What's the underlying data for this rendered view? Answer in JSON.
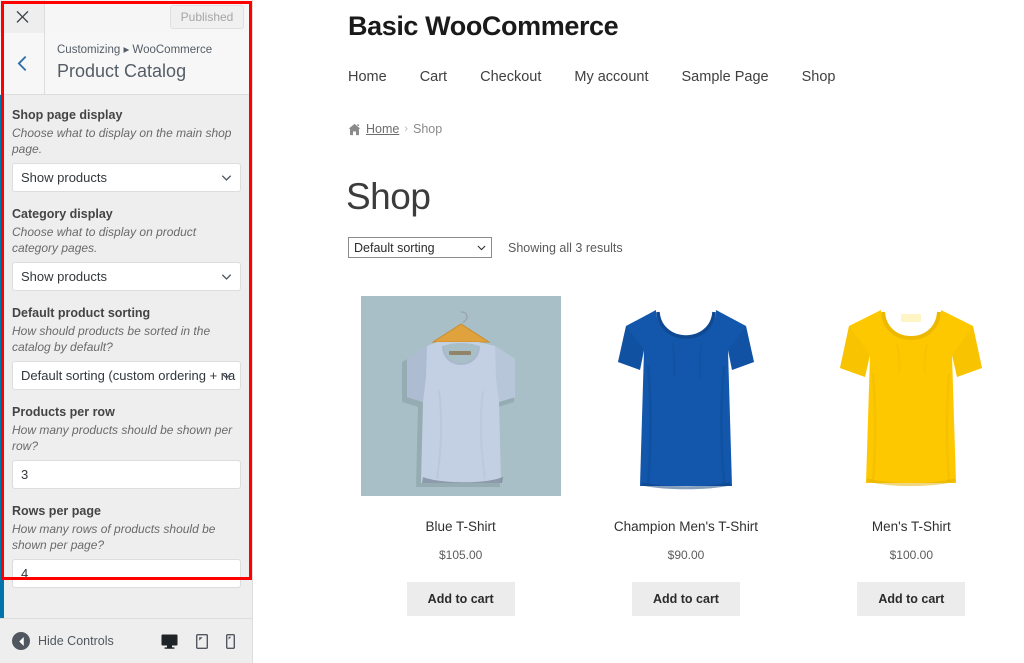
{
  "customizer": {
    "close_icon": "close-icon",
    "published_label": "Published",
    "back_icon": "chevron-left-icon",
    "breadcrumb": "Customizing ▸ WooCommerce",
    "panel_title": "Product Catalog",
    "controls": [
      {
        "id": "shop-page-display",
        "label": "Shop page display",
        "description": "Choose what to display on the main shop page.",
        "type": "select",
        "value": "Show products"
      },
      {
        "id": "category-display",
        "label": "Category display",
        "description": "Choose what to display on product category pages.",
        "type": "select",
        "value": "Show products"
      },
      {
        "id": "default-product-sorting",
        "label": "Default product sorting",
        "description": "How should products be sorted in the catalog by default?",
        "type": "select",
        "value": "Default sorting (custom ordering + na"
      },
      {
        "id": "products-per-row",
        "label": "Products per row",
        "description": "How many products should be shown per row?",
        "type": "number",
        "value": "3"
      },
      {
        "id": "rows-per-page",
        "label": "Rows per page",
        "description": "How many rows of products should be shown per page?",
        "type": "number",
        "value": "4"
      }
    ],
    "footer": {
      "hide_controls_label": "Hide Controls",
      "hide_icon": "caret-left-circle-icon",
      "devices": [
        {
          "name": "desktop",
          "icon": "desktop-icon",
          "active": true
        },
        {
          "name": "tablet",
          "icon": "tablet-icon",
          "active": false
        },
        {
          "name": "mobile",
          "icon": "mobile-icon",
          "active": false
        }
      ]
    },
    "annotation_color": "#ff0000",
    "accent_color": "#0073aa"
  },
  "preview": {
    "site_title": "Basic WooCommerce",
    "nav": [
      {
        "label": "Home"
      },
      {
        "label": "Cart"
      },
      {
        "label": "Checkout"
      },
      {
        "label": "My account"
      },
      {
        "label": "Sample Page"
      },
      {
        "label": "Shop"
      }
    ],
    "breadcrumb": {
      "home_icon": "home-icon",
      "home_label": "Home",
      "separator": "›",
      "current": "Shop"
    },
    "page_heading": "Shop",
    "sorting": {
      "value": "Default sorting",
      "chevron_icon": "chevron-down-icon"
    },
    "result_count": "Showing all 3 results",
    "products": [
      {
        "title": "Blue T-Shirt",
        "price": "$105.00",
        "add_to_cart_label": "Add to cart",
        "image": {
          "name": "light-blue-tshirt-on-hanger",
          "background": "#a9bfc7",
          "shirt_color": "#c3d0e4",
          "shirt_shade": "#aebcd2",
          "hanger_color": "#e0a23c",
          "has_background_box": true
        }
      },
      {
        "title": "Champion Men's T-Shirt",
        "price": "$90.00",
        "add_to_cart_label": "Add to cart",
        "image": {
          "name": "royal-blue-tshirt",
          "background": "#ffffff",
          "shirt_color": "#1257ab",
          "shirt_shade": "#0f4992",
          "hanger_color": "",
          "has_background_box": false
        }
      },
      {
        "title": "Men's T-Shirt",
        "price": "$100.00",
        "add_to_cart_label": "Add to cart",
        "image": {
          "name": "yellow-tshirt",
          "background": "#ffffff",
          "shirt_color": "#fdc800",
          "shirt_shade": "#edb900",
          "hanger_color": "",
          "has_background_box": false
        }
      }
    ]
  }
}
